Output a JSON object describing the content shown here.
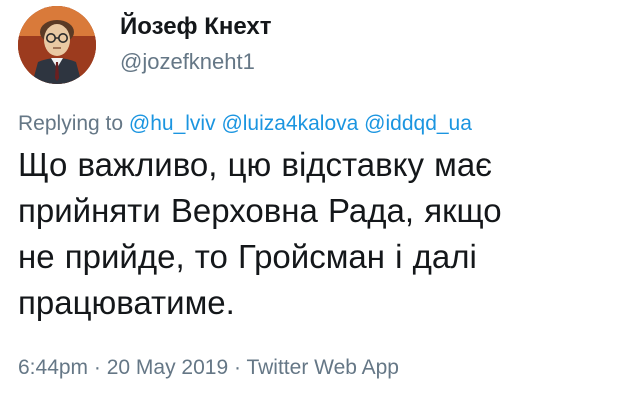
{
  "author": {
    "display_name": "Йозеф Кнехт",
    "handle": "@jozefkneht1"
  },
  "reply": {
    "prefix": "Replying to",
    "mentions": [
      "@hu_lviv",
      "@luiza4kalova",
      "@iddqd_ua"
    ]
  },
  "tweet": {
    "text": "Що важливо,  цю відставку має\nприйняти Верховна Рада,  якщо\nне прийде,  то Гройсман і далі\nпрацюватиме."
  },
  "meta": {
    "time": "6:44pm",
    "separator": "·",
    "date": "20 May 2019",
    "source": "Twitter Web App"
  },
  "colors": {
    "text": "#14171a",
    "secondary": "#657786",
    "link": "#1b95e0"
  }
}
